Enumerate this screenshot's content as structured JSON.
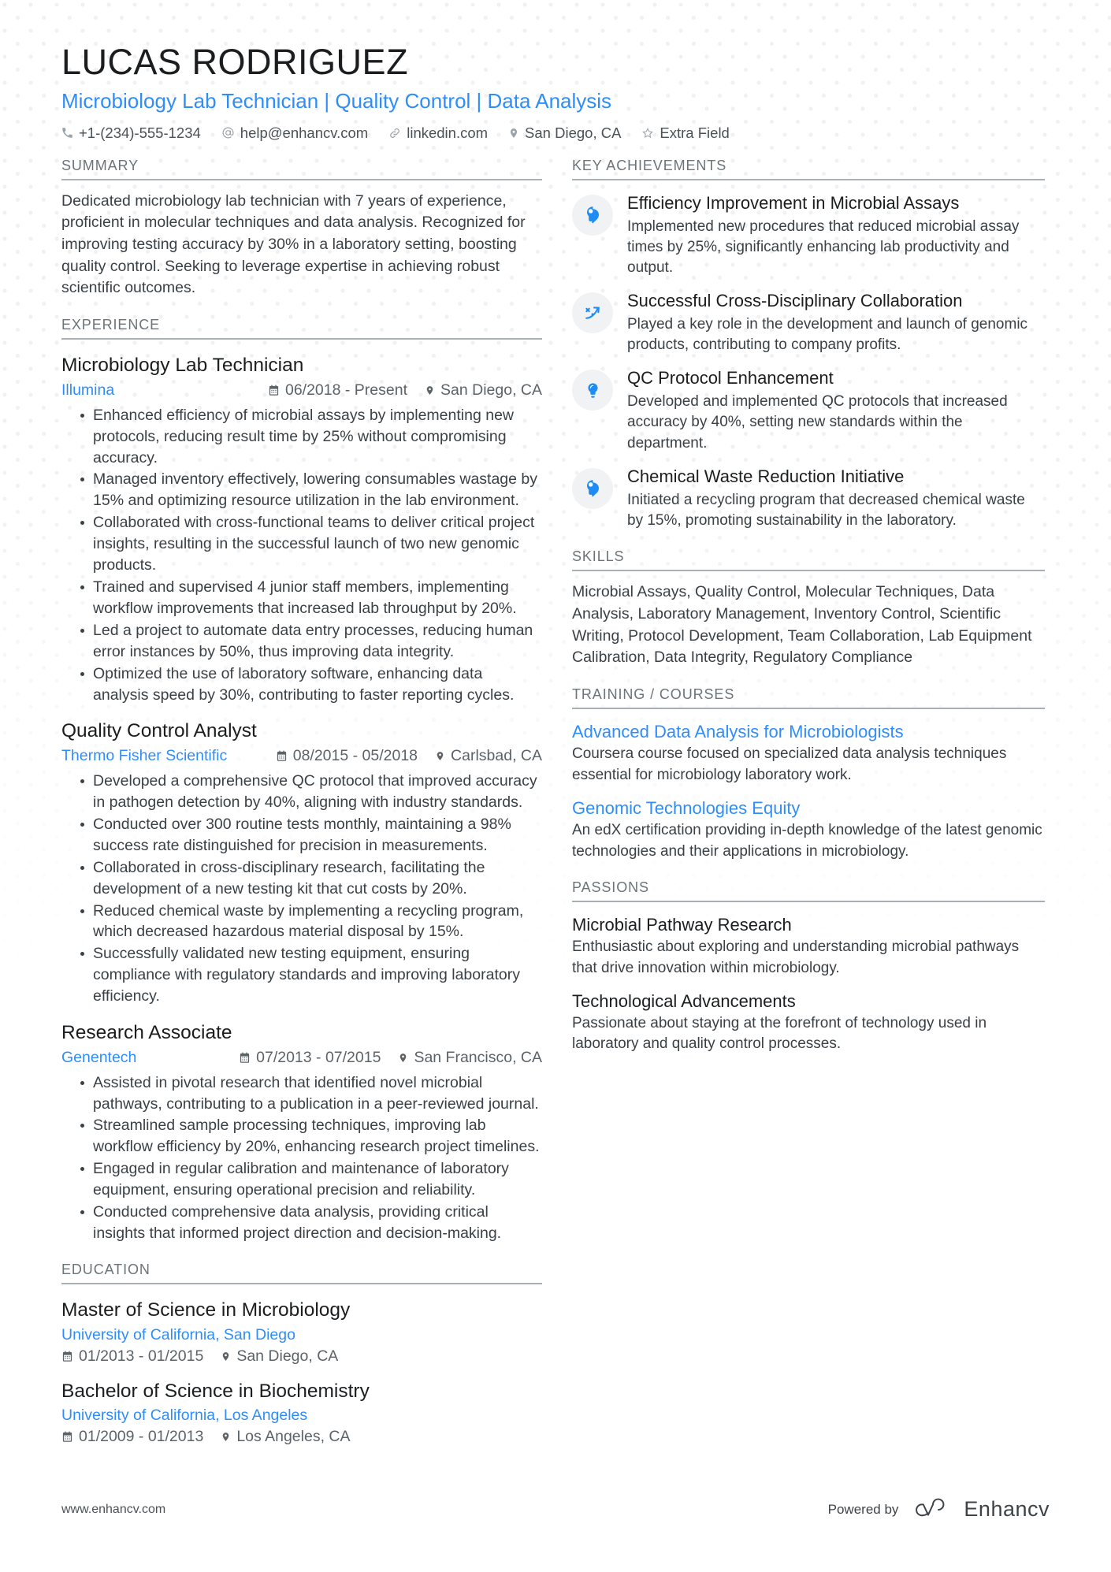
{
  "header": {
    "name": "LUCAS RODRIGUEZ",
    "role": "Microbiology Lab Technician | Quality Control | Data Analysis",
    "contacts": [
      {
        "icon": "phone-icon",
        "text": "+1-(234)-555-1234"
      },
      {
        "icon": "at-sign-icon",
        "text": "help@enhancv.com"
      },
      {
        "icon": "link-icon",
        "text": "linkedin.com"
      },
      {
        "icon": "location-pin-icon",
        "text": "San Diego, CA"
      },
      {
        "icon": "star-icon",
        "text": "Extra Field"
      }
    ]
  },
  "summary": {
    "heading": "SUMMARY",
    "text": "Dedicated microbiology lab technician with 7 years of experience, proficient in molecular techniques and data analysis. Recognized for improving testing accuracy by 30% in a laboratory setting, boosting quality control. Seeking to leverage expertise in achieving robust scientific outcomes."
  },
  "experience": {
    "heading": "EXPERIENCE",
    "entries": [
      {
        "title": "Microbiology Lab Technician",
        "org": "Illumina",
        "dates": "06/2018 - Present",
        "location": "San Diego, CA",
        "bullets": [
          "Enhanced efficiency of microbial assays by implementing new protocols, reducing result time by 25% without compromising accuracy.",
          "Managed inventory effectively, lowering consumables wastage by 15% and optimizing resource utilization in the lab environment.",
          "Collaborated with cross-functional teams to deliver critical project insights, resulting in the successful launch of two new genomic products.",
          "Trained and supervised 4 junior staff members, implementing workflow improvements that increased lab throughput by 20%.",
          "Led a project to automate data entry processes, reducing human error instances by 50%, thus improving data integrity.",
          "Optimized the use of laboratory software, enhancing data analysis speed by 30%, contributing to faster reporting cycles."
        ]
      },
      {
        "title": "Quality Control Analyst",
        "org": "Thermo Fisher Scientific",
        "dates": "08/2015 - 05/2018",
        "location": "Carlsbad, CA",
        "bullets": [
          "Developed a comprehensive QC protocol that improved accuracy in pathogen detection by 40%, aligning with industry standards.",
          "Conducted over 300 routine tests monthly, maintaining a 98% success rate distinguished for precision in measurements.",
          "Collaborated in cross-disciplinary research, facilitating the development of a new testing kit that cut costs by 20%.",
          "Reduced chemical waste by implementing a recycling program, which decreased hazardous material disposal by 15%.",
          "Successfully validated new testing equipment, ensuring compliance with regulatory standards and improving laboratory efficiency."
        ]
      },
      {
        "title": "Research Associate",
        "org": "Genentech",
        "dates": "07/2013 - 07/2015",
        "location": "San Francisco, CA",
        "bullets": [
          "Assisted in pivotal research that identified novel microbial pathways, contributing to a publication in a peer-reviewed journal.",
          "Streamlined sample processing techniques, improving lab workflow efficiency by 20%, enhancing research project timelines.",
          "Engaged in regular calibration and maintenance of laboratory equipment, ensuring operational precision and reliability.",
          "Conducted comprehensive data analysis, providing critical insights that informed project direction and decision-making."
        ]
      }
    ]
  },
  "education": {
    "heading": "EDUCATION",
    "entries": [
      {
        "degree": "Master of Science in Microbiology",
        "school": "University of California, San Diego",
        "dates": "01/2013 - 01/2015",
        "location": "San Diego, CA"
      },
      {
        "degree": "Bachelor of Science in Biochemistry",
        "school": "University of California, Los Angeles",
        "dates": "01/2009 - 01/2013",
        "location": "Los Angeles, CA"
      }
    ]
  },
  "achievements": {
    "heading": "KEY ACHIEVEMENTS",
    "items": [
      {
        "icon": "head-idea-icon",
        "title": "Efficiency Improvement in Microbial Assays",
        "desc": "Implemented new procedures that reduced microbial assay times by 25%, significantly enhancing lab productivity and output."
      },
      {
        "icon": "trend-arrow-icon",
        "title": "Successful Cross-Disciplinary Collaboration",
        "desc": "Played a key role in the development and launch of genomic products, contributing to company profits."
      },
      {
        "icon": "lightbulb-icon",
        "title": "QC Protocol Enhancement",
        "desc": "Developed and implemented QC protocols that increased accuracy by 40%, setting new standards within the department."
      },
      {
        "icon": "head-idea-icon",
        "title": "Chemical Waste Reduction Initiative",
        "desc": "Initiated a recycling program that decreased chemical waste by 15%, promoting sustainability in the laboratory."
      }
    ]
  },
  "skills": {
    "heading": "SKILLS",
    "text": "Microbial Assays, Quality Control, Molecular Techniques, Data Analysis, Laboratory Management, Inventory Control, Scientific Writing, Protocol Development, Team Collaboration, Lab Equipment Calibration, Data Integrity, Regulatory Compliance"
  },
  "training": {
    "heading": "TRAINING / COURSES",
    "items": [
      {
        "title": "Advanced Data Analysis for Microbiologists",
        "desc": "Coursera course focused on specialized data analysis techniques essential for microbiology laboratory work."
      },
      {
        "title": "Genomic Technologies Equity",
        "desc": "An edX certification providing in-depth knowledge of the latest genomic technologies and their applications in microbiology."
      }
    ]
  },
  "passions": {
    "heading": "PASSIONS",
    "items": [
      {
        "title": "Microbial Pathway Research",
        "desc": "Enthusiastic about exploring and understanding microbial pathways that drive innovation within microbiology."
      },
      {
        "title": "Technological Advancements",
        "desc": "Passionate about staying at the forefront of technology used in laboratory and quality control processes."
      }
    ]
  },
  "footer": {
    "url": "www.enhancv.com",
    "powered_by": "Powered by",
    "brand": "Enhancv"
  },
  "colors": {
    "accent": "#2f8dfa",
    "text": "#3a4146",
    "heading": "#6b7479",
    "badge_bg": "#f1f2f3"
  }
}
